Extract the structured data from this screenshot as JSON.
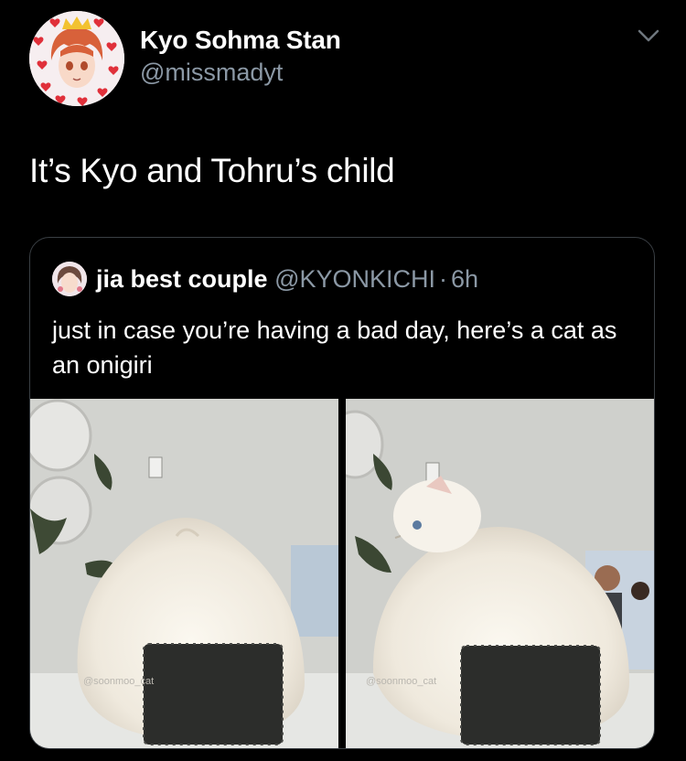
{
  "tweet": {
    "author_name": "Kyo Sohma Stan",
    "author_handle": "@missmadyt",
    "text": "It’s Kyo and Tohru’s child",
    "avatar_icon": "anime-avatar-hearts",
    "menu_icon": "chevron-down-icon"
  },
  "quoted": {
    "author_name": "jia best couple",
    "author_handle": "@KYONKICHI",
    "separator": "·",
    "time": "6h",
    "text": "just in case you’re having a bad day, here’s a cat as an onigiri",
    "media": [
      {
        "watermark": "@soonmoo_cat",
        "alt": "white cat shaped like onigiri"
      },
      {
        "watermark": "@soonmoo_cat",
        "alt": "white cat looking back, onigiri shape"
      }
    ]
  },
  "colors": {
    "background": "#000000",
    "text": "#ffffff",
    "secondary": "#8b98a5",
    "border": "#3a3f44"
  }
}
